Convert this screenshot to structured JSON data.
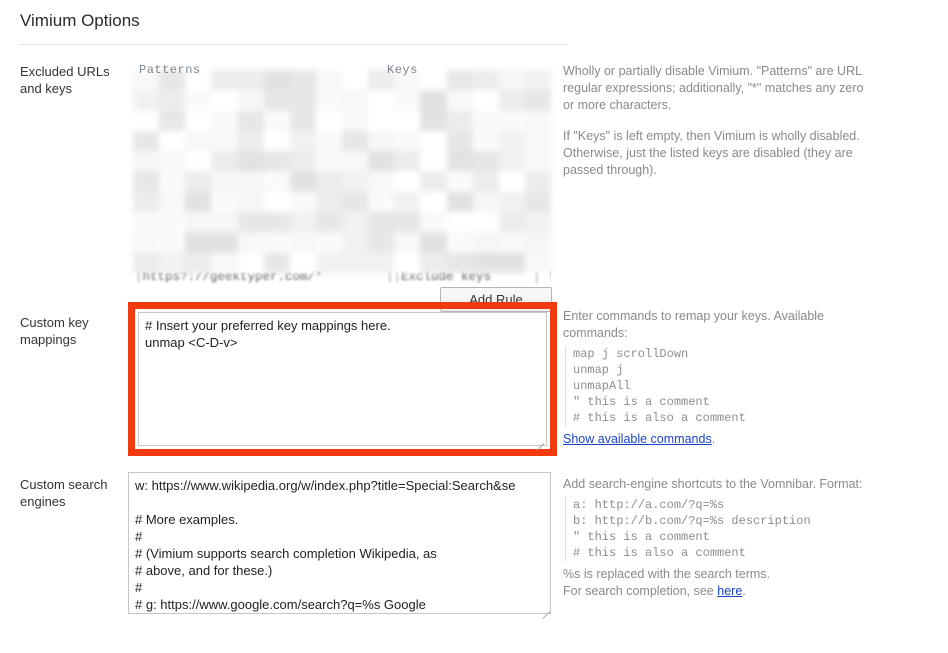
{
  "header": {
    "title": "Vimium Options"
  },
  "sections": {
    "excluded": {
      "label": "Excluded URLs\nand keys",
      "label_line1": "Excluded URLs",
      "label_line2": "and keys",
      "columns": {
        "patterns": "Patterns",
        "keys": "Keys"
      },
      "rule": {
        "pattern": "https?://geektyper.com/*",
        "keys": "Exclude keys",
        "delete_icon": "trash-icon"
      },
      "add_rule_label": "Add Rule",
      "help": {
        "p1": "Wholly or partially disable Vimium. \"Patterns\" are URL regular expressions; additionally, \"*\" matches any zero or more characters.",
        "p2": "If \"Keys\" is left empty, then Vimium is wholly disabled. Otherwise, just the listed keys are disabled (they are passed through)."
      }
    },
    "keymappings": {
      "label_line1": "Custom key",
      "label_line2": "mappings",
      "textarea_value": "# Insert your preferred key mappings here.\nunmap <C-D-v>",
      "textarea_placeholder": "",
      "highlighted": true,
      "highlight_color": "#F23A10",
      "help": {
        "intro": "Enter commands to remap your keys. Available commands:",
        "code": "map j scrollDown\nunmap j\nunmapAll\n\" this is a comment\n# this is also a comment",
        "link_text": "Show available commands",
        "link_suffix": "."
      }
    },
    "searchengines": {
      "label_line1": "Custom search",
      "label_line2": "engines",
      "textarea_value": "w: https://www.wikipedia.org/w/index.php?title=Special:Search&se\n\n# More examples.\n#\n# (Vimium supports search completion Wikipedia, as\n# above, and for these.)\n#\n# g: https://www.google.com/search?q=%s Google\n# l: https://www.google.com/search?q=%s&btnI I'm feeling lucky",
      "help": {
        "intro": "Add search-engine shortcuts to the Vomnibar. Format:",
        "code": "a: http://a.com/?q=%s\nb: http://b.com/?q=%s description\n\" this is a comment\n# this is also a comment",
        "note1": "%s is replaced with the search terms.",
        "note2_prefix": "For search completion, see ",
        "link_text": "here",
        "note2_suffix": "."
      }
    }
  }
}
